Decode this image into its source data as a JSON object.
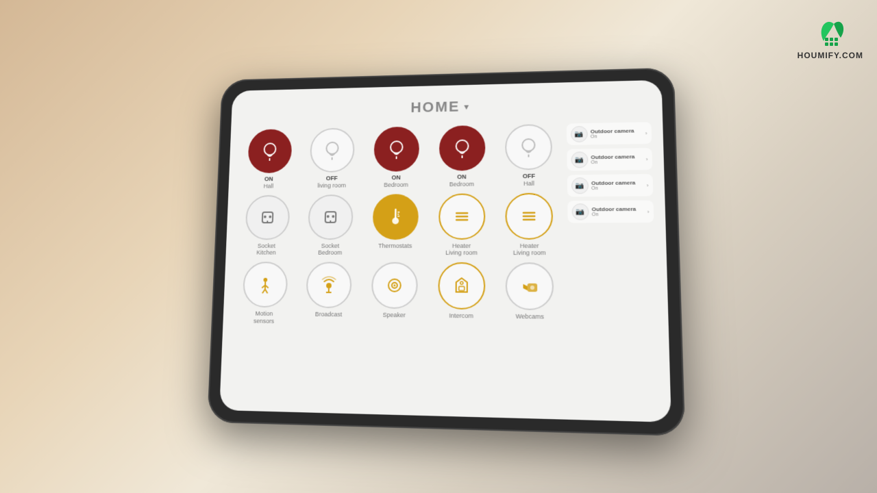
{
  "page": {
    "title": "HOME",
    "chevron": "▾"
  },
  "devices": [
    {
      "id": "light-hall-on",
      "icon": "💡",
      "status": "ON",
      "room": "Hall",
      "style": "active-red"
    },
    {
      "id": "light-living-off",
      "icon": "💡",
      "status": "OFF",
      "room": "living room",
      "style": "inactive-light"
    },
    {
      "id": "light-bedroom-on",
      "icon": "💡",
      "status": "ON",
      "room": "Bedroom",
      "style": "active-dark-red"
    },
    {
      "id": "light-bedroom-on2",
      "icon": "💡",
      "status": "ON",
      "room": "Bedroom",
      "style": "active-dark-red"
    },
    {
      "id": "light-hall-off",
      "icon": "💡",
      "status": "OFF",
      "room": "Hall",
      "style": "inactive-light"
    },
    {
      "id": "socket-kitchen",
      "icon": "🔌",
      "status": "",
      "room": "Socket\nKitchen",
      "style": "socket-style"
    },
    {
      "id": "socket-bedroom",
      "icon": "🔌",
      "status": "",
      "room": "Socket\nBedroom",
      "style": "socket-style"
    },
    {
      "id": "thermostats",
      "icon": "🌡",
      "status": "",
      "room": "Thermostats",
      "style": "thermostat-style"
    },
    {
      "id": "heater-living",
      "icon": "☰",
      "status": "",
      "room": "Heater\nLiving room",
      "style": "heater-style"
    },
    {
      "id": "heater-living2",
      "icon": "☰",
      "status": "",
      "room": "Heater\nLiving room",
      "style": "heater-style"
    },
    {
      "id": "motion-sensors",
      "icon": "🚶",
      "status": "",
      "room": "Motion\nsensors",
      "style": "motion-style"
    },
    {
      "id": "broadcast",
      "icon": "📢",
      "status": "",
      "room": "Broadcast",
      "style": "broadcast-style"
    },
    {
      "id": "speaker",
      "icon": "🎵",
      "status": "",
      "room": "Speaker",
      "style": "speaker-style"
    },
    {
      "id": "intercom",
      "icon": "🏠",
      "status": "",
      "room": "Intercom",
      "style": "intercom-style"
    },
    {
      "id": "webcams",
      "icon": "📷",
      "status": "",
      "room": "Webcams",
      "style": "webcam-style"
    }
  ],
  "cameras": [
    {
      "id": "cam1",
      "name": "Outdoor camera",
      "status": "On"
    },
    {
      "id": "cam2",
      "name": "Outdoor camera",
      "status": "On"
    },
    {
      "id": "cam3",
      "name": "Outdoor camera",
      "status": "On"
    },
    {
      "id": "cam4",
      "name": "Outdoor camera",
      "status": "On"
    }
  ],
  "logo": {
    "text": "HOUMIFY.COM"
  }
}
